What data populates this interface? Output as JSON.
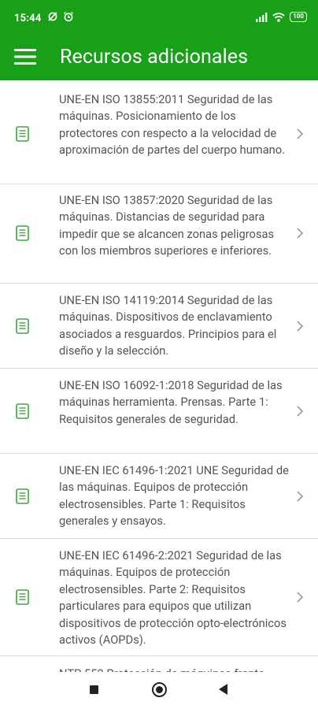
{
  "status_bar": {
    "time": "15:44",
    "battery": "100",
    "left_icons": [
      "sync-off-icon",
      "alarm-icon"
    ],
    "right_icons": [
      "signal-icon",
      "wifi-icon",
      "battery-icon"
    ]
  },
  "app_bar": {
    "title": "Recursos adicionales",
    "menu_icon": "hamburger-menu-icon",
    "background": "#18a118"
  },
  "resources": [
    {
      "text": "UNE-EN ISO 13855:2011 Seguridad de las máquinas. Posicionamiento de los protectores con respecto a la velocidad de aproximación de partes del cuerpo humano."
    },
    {
      "text": "UNE-EN ISO 13857:2020 Seguridad de las máquinas. Distancias de seguridad para impedir que se alcancen zonas peligrosas con los miembros superiores e inferiores."
    },
    {
      "text": "UNE-EN ISO 14119:2014 Seguridad de las máquinas. Dispositivos de enclavamiento asociados a resguardos. Principios para el diseño y la selección."
    },
    {
      "text": "UNE-EN ISO 16092-1:2018 Seguridad de las máquinas herramienta. Prensas. Parte 1: Requisitos generales de seguridad."
    },
    {
      "text": "UNE-EN IEC 61496-1:2021 UNE Seguridad de las máquinas. Equipos de protección electrosensibles. Parte 1: Requisitos generales y ensayos."
    },
    {
      "text": "UNE-EN IEC 61496-2:2021 Seguridad de las máquinas. Equipos de protección electrosensibles. Parte 2: Requisitos particulares para equipos que utilizan dispositivos de protección opto-electrónicos activos (AOPDs)."
    },
    {
      "text": "NTP 552 Protección de máquinas frente"
    }
  ],
  "icons": {
    "item_icon": "document-icon",
    "item_icon_color": "#3aa83a",
    "trailing_icon": "chevron-right-icon"
  },
  "nav_bar": {
    "buttons": [
      "recents-button",
      "home-button",
      "back-button"
    ]
  }
}
